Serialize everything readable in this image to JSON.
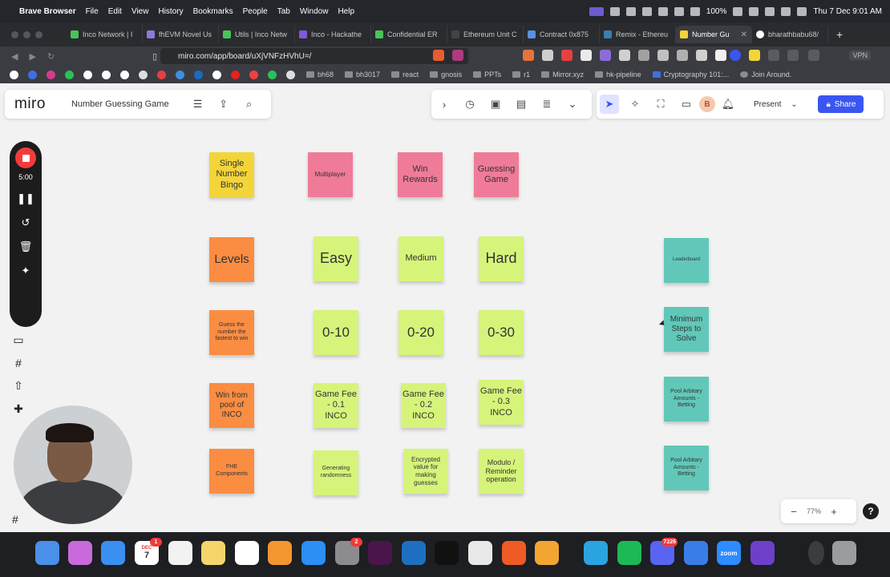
{
  "menubar": {
    "app": "Brave Browser",
    "items": [
      "File",
      "Edit",
      "View",
      "History",
      "Bookmarks",
      "People",
      "Tab",
      "Window",
      "Help"
    ],
    "battery": "100%",
    "datetime": "Thu 7 Dec  9:01 AM"
  },
  "tabs": [
    {
      "label": "Inco Network | I",
      "color": "#48c45a"
    },
    {
      "label": "fhEVM Novel Us",
      "color": "#8b7bd8"
    },
    {
      "label": "Utils | Inco Netw",
      "color": "#48c45a"
    },
    {
      "label": "Inco - Hackathe",
      "color": "#7b5bd8"
    },
    {
      "label": "Confidential ER",
      "color": "#48c45a"
    },
    {
      "label": "Ethereum Unit C",
      "color": "#444"
    },
    {
      "label": "Contract 0x875",
      "color": "#5b8fe0"
    },
    {
      "label": "Remix - Ethereu",
      "color": "#3a7fb0"
    },
    {
      "label": "Number Gu",
      "color": "#f3d53a",
      "active": true
    },
    {
      "label": "bharathbabu68/",
      "color": "#ffffff"
    }
  ],
  "address": {
    "url": "miro.com/app/board/uXjVNFzHVhU=/",
    "vpn": "VPN"
  },
  "bookmarks": [
    "bh68",
    "bh3017",
    "react",
    "gnosis",
    "PPTs",
    "r1",
    "Mirror.xyz",
    "hk-pipeline",
    "Cryptography 101:...",
    "Join Around."
  ],
  "miro": {
    "logo": "miro",
    "board_name": "Number Guessing Game",
    "present": "Present",
    "share": "Share",
    "avatar": "B",
    "zoom": "77%",
    "help": "?"
  },
  "recorder": {
    "time": "5:00"
  },
  "stickies": {
    "r1c1": "Single Number Bingo",
    "r1c2": "Multiplayer",
    "r1c3": "Win Rewards",
    "r1c4": "Guessing Game",
    "r2c1": "Levels",
    "r2c2": "Easy",
    "r2c3": "Medium",
    "r2c4": "Hard",
    "r3c1": "Guess the number the fastest to win",
    "r3c2": "0-10",
    "r3c3": "0-20",
    "r3c4": "0-30",
    "r4c1": "Win from pool of INCO",
    "r4c2": "Game Fee - 0.1 INCO",
    "r4c3": "Game Fee - 0.2 INCO",
    "r4c4": "Game Fee - 0.3 INCO",
    "r5c1": "FHE Components",
    "r5c2": "Generating randomness",
    "r5c3": "Encrypted value for making guesses",
    "r5c4": "Modulo / Reminder operation",
    "t1": "Leaderboard",
    "t2": "Minimum Steps to Solve",
    "t3": "Pool Arbitary Amounts - Betting",
    "t4": "Pool Arbitary Amounts - Betting"
  },
  "dock": {
    "calendar_month": "DEC",
    "calendar_day": "7",
    "calendar_badge": "1",
    "settings_badge": "2",
    "discord_badge": "7226",
    "zoom_label": "zoom"
  }
}
